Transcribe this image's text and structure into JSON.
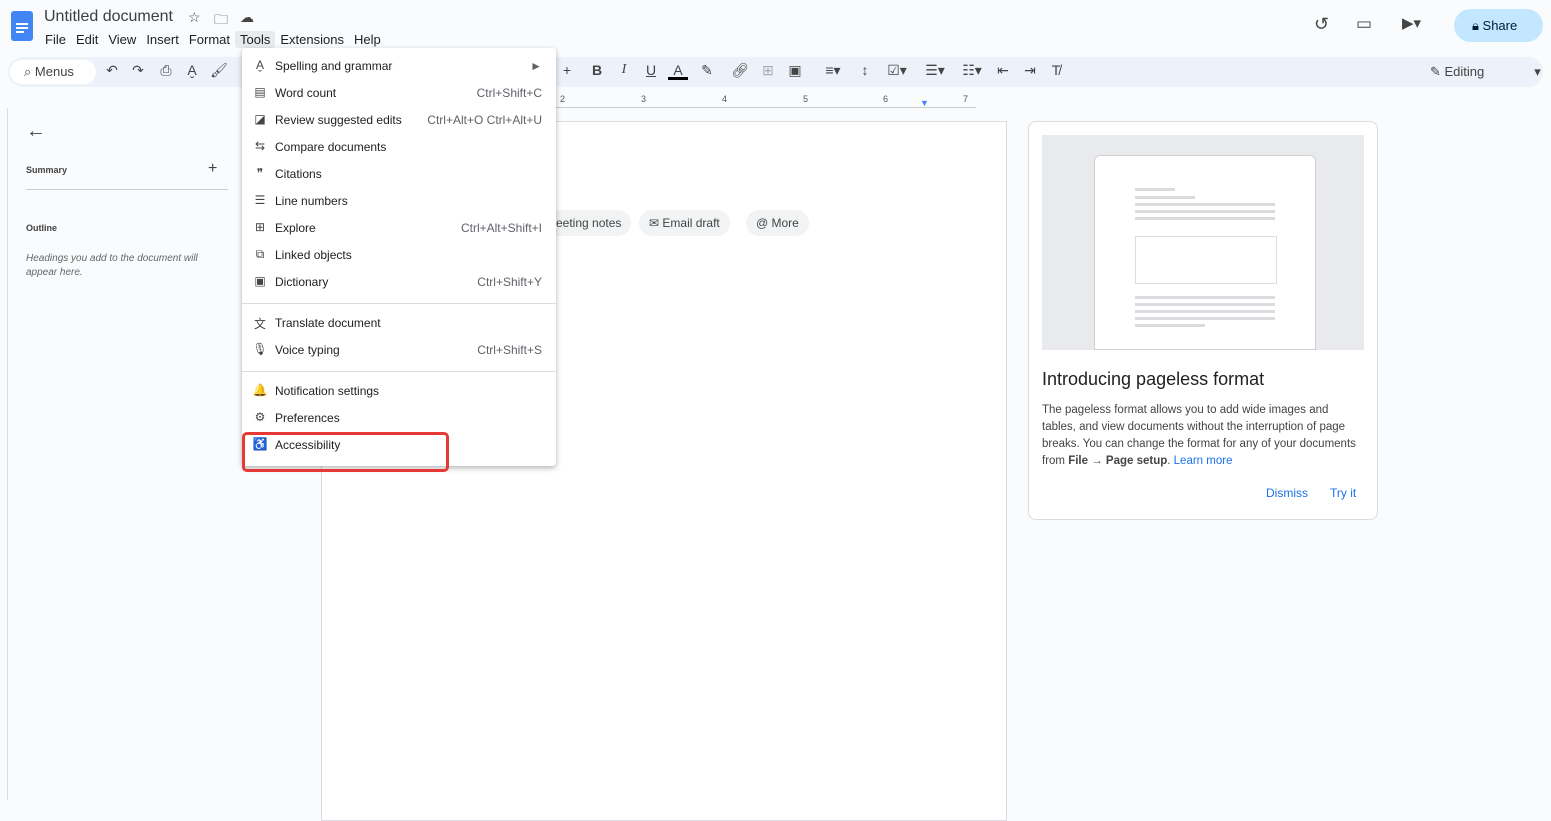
{
  "doc": {
    "title": "Untitled document"
  },
  "menubar": [
    "File",
    "Edit",
    "View",
    "Insert",
    "Format",
    "Tools",
    "Extensions",
    "Help"
  ],
  "toolbar": {
    "search_label": "Menus",
    "mode": "Editing"
  },
  "header": {
    "share_label": "Share"
  },
  "ruler": [
    "2",
    "3",
    "4",
    "5",
    "6",
    "7"
  ],
  "sidebar": {
    "summary": "Summary",
    "outline": "Outline",
    "hint": "Headings you add to the document will appear here."
  },
  "chips": [
    "eeting notes",
    "Email draft",
    "More"
  ],
  "tools_menu": {
    "items": [
      {
        "icon": "spellcheck-icon",
        "glyph": "A̬",
        "label": "Spelling and grammar",
        "shortcut": "►"
      },
      {
        "icon": "word-count-icon",
        "glyph": "▤",
        "label": "Word count",
        "shortcut": "Ctrl+Shift+C"
      },
      {
        "icon": "review-edits-icon",
        "glyph": "◪",
        "label": "Review suggested edits",
        "shortcut": "Ctrl+Alt+O Ctrl+Alt+U"
      },
      {
        "icon": "compare-icon",
        "glyph": "⇆",
        "label": "Compare documents",
        "shortcut": ""
      },
      {
        "icon": "citations-icon",
        "glyph": "❞",
        "label": "Citations",
        "shortcut": ""
      },
      {
        "icon": "line-numbers-icon",
        "glyph": "☰",
        "label": "Line numbers",
        "shortcut": ""
      },
      {
        "icon": "explore-icon",
        "glyph": "⊞",
        "label": "Explore",
        "shortcut": "Ctrl+Alt+Shift+I"
      },
      {
        "icon": "linked-objects-icon",
        "glyph": "⧉",
        "label": "Linked objects",
        "shortcut": ""
      },
      {
        "icon": "dictionary-icon",
        "glyph": "▣",
        "label": "Dictionary",
        "shortcut": "Ctrl+Shift+Y"
      },
      {
        "icon": "translate-icon",
        "glyph": "文",
        "label": "Translate document",
        "shortcut": ""
      },
      {
        "icon": "microphone-icon",
        "glyph": "🎙",
        "label": "Voice typing",
        "shortcut": "Ctrl+Shift+S"
      },
      {
        "icon": "bell-icon",
        "glyph": "🔔",
        "label": "Notification settings",
        "shortcut": ""
      },
      {
        "icon": "preferences-icon",
        "glyph": "⚙",
        "label": "Preferences",
        "shortcut": ""
      },
      {
        "icon": "accessibility-icon",
        "glyph": "♿",
        "label": "Accessibility",
        "shortcut": ""
      }
    ]
  },
  "promo": {
    "title": "Introducing pageless format",
    "body": "The pageless format allows you to add wide images and tables, and view documents without the interruption of page breaks. You can change the format for any of your documents from ",
    "bold": "File → Page setup",
    "after": ". ",
    "link": "Learn more",
    "dismiss": "Dismiss",
    "try": "Try it"
  },
  "colors": {
    "accent": "#1a73e8",
    "highlight": "#e53935",
    "share_bg": "#c2e7ff",
    "toolbar_bg": "#edf2fa"
  }
}
